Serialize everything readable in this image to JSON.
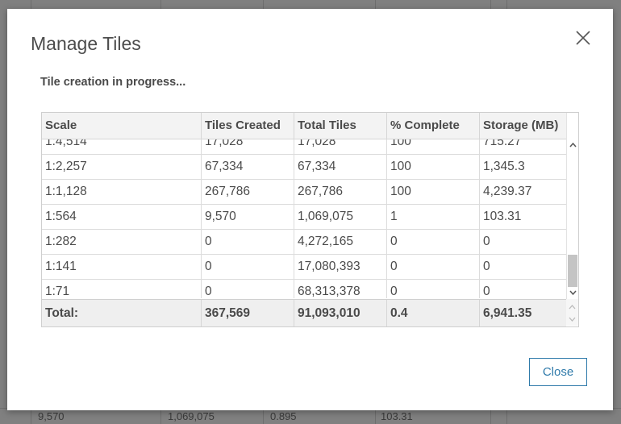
{
  "dialog": {
    "title": "Manage Tiles",
    "status": "Tile creation in progress...",
    "close_label": "Close"
  },
  "table": {
    "headers": [
      "Scale",
      "Tiles Created",
      "Total Tiles",
      "% Complete",
      "Storage (MB)"
    ],
    "rows": [
      [
        "1:4,514",
        "17,028",
        "17,028",
        "100",
        "715.27"
      ],
      [
        "1:2,257",
        "67,334",
        "67,334",
        "100",
        "1,345.3"
      ],
      [
        "1:1,128",
        "267,786",
        "267,786",
        "100",
        "4,239.37"
      ],
      [
        "1:564",
        "9,570",
        "1,069,075",
        "1",
        "103.31"
      ],
      [
        "1:282",
        "0",
        "4,272,165",
        "0",
        "0"
      ],
      [
        "1:141",
        "0",
        "17,080,393",
        "0",
        "0"
      ],
      [
        "1:71",
        "0",
        "68,313,378",
        "0",
        "0"
      ]
    ],
    "footer": [
      "Total:",
      "367,569",
      "91,093,010",
      "0.4",
      "6,941.35"
    ]
  },
  "background": {
    "bottom_row": [
      "9,570",
      "1,069,075",
      "0.895",
      "103.31"
    ]
  },
  "colors": {
    "accent": "#2f7aaa",
    "header_bg": "#f3f3f3",
    "footer_bg": "#efefef"
  },
  "icons": {
    "close": "close-icon",
    "scroll_up": "chevron-up-icon",
    "scroll_down": "chevron-down-icon"
  }
}
